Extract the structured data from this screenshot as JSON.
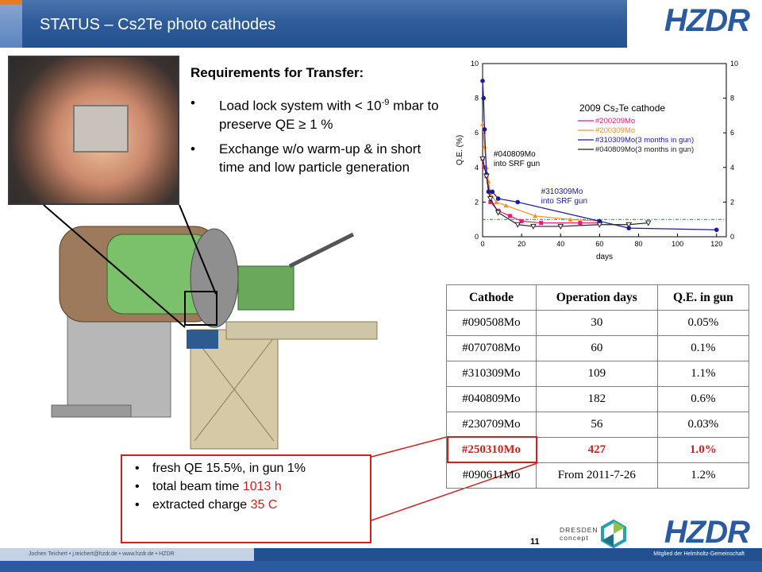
{
  "header": {
    "title": "STATUS – Cs2Te photo cathodes",
    "logo": "HZDR"
  },
  "requirements": {
    "title": "Requirements for Transfer:",
    "items": [
      {
        "text_before": "Load lock system with < 10",
        "sup": "-9",
        "text_after": " mbar to preserve QE  ≥ 1 %"
      },
      {
        "text_before": "Exchange w/o warm-up & in short time and low particle generation",
        "sup": "",
        "text_after": ""
      }
    ]
  },
  "chart_data": {
    "type": "line",
    "title": "2009 Cs₂Te cathode",
    "xlabel": "days",
    "ylabel": "Q.E. (%)",
    "xlim": [
      0,
      125
    ],
    "ylim": [
      0,
      10
    ],
    "y2lim": [
      0,
      10
    ],
    "xticks": [
      0,
      20,
      40,
      60,
      80,
      100,
      120
    ],
    "yticks": [
      0,
      2,
      4,
      6,
      8,
      10
    ],
    "y2ticks": [
      0,
      2,
      4,
      6,
      8,
      10
    ],
    "threshold": 1,
    "legend_position": "right",
    "annotations": [
      {
        "text": "#040809Mo",
        "text2": "into SRF gun",
        "x": 4,
        "y": 4.4
      },
      {
        "text": "#310309Mo",
        "text2": "into SRF gun",
        "x": 37,
        "y": 2.5
      }
    ],
    "series": [
      {
        "name": "#200209Mo",
        "color": "#e8197a",
        "marker": "square",
        "x": [
          0,
          1,
          2,
          4,
          8,
          14,
          20,
          30,
          50,
          60
        ],
        "y": [
          4.5,
          4.0,
          3.5,
          2.0,
          1.5,
          1.2,
          0.9,
          0.8,
          0.8,
          0.8
        ]
      },
      {
        "name": "#200309Mo",
        "color": "#f0902a",
        "marker": "triangle",
        "x": [
          0,
          1,
          2,
          3,
          4,
          7,
          12,
          27,
          45,
          60
        ],
        "y": [
          6.5,
          5.2,
          4.0,
          3.2,
          2.5,
          2.0,
          1.8,
          1.2,
          1.0,
          0.9
        ]
      },
      {
        "name": "#310309Mo(3 months in gun)",
        "color": "#1a1aa8",
        "marker": "circle",
        "x": [
          0,
          0.5,
          1,
          2,
          3,
          5,
          8,
          18,
          60,
          75,
          120
        ],
        "y": [
          9.0,
          8.0,
          6.2,
          3.6,
          2.6,
          2.6,
          2.2,
          2.0,
          0.9,
          0.5,
          0.4
        ]
      },
      {
        "name": "#040809Mo(3 months in gun)",
        "color": "#222222",
        "marker": "triangle-down",
        "x": [
          0,
          2,
          4,
          8,
          18,
          26,
          40,
          60,
          75,
          85
        ],
        "y": [
          4.5,
          3.5,
          2.2,
          1.4,
          0.7,
          0.6,
          0.6,
          0.7,
          0.7,
          0.8
        ]
      }
    ]
  },
  "table": {
    "headers": [
      "Cathode",
      "Operation days",
      "Q.E. in gun"
    ],
    "rows": [
      [
        "#090508Mo",
        "30",
        "0.05%"
      ],
      [
        "#070708Mo",
        "60",
        "0.1%"
      ],
      [
        "#310309Mo",
        "109",
        "1.1%"
      ],
      [
        "#040809Mo",
        "182",
        "0.6%"
      ],
      [
        "#230709Mo",
        "56",
        "0.03%"
      ],
      [
        "#250310Mo",
        "427",
        "1.0%"
      ],
      [
        "#090611Mo",
        "From 2011-7-26",
        "1.2%"
      ]
    ],
    "highlight_row": 5
  },
  "info": {
    "item1": "fresh QE 15.5%, in gun 1%",
    "item2_prefix": "total beam time ",
    "item2_value": "1013 h",
    "item3_prefix": "extracted charge ",
    "item3_value": "35 C"
  },
  "footer": {
    "author_line": "Jochen Teichert  •  j.teichert@hzdr.de  •  www.hzdr.de  •  HZDR",
    "page_number": "11",
    "member": "Mitglied der Helmholtz-Gemeinschaft",
    "partner_line1": "DRESDEN",
    "partner_line2": "concept"
  },
  "colors": {
    "brand_blue": "#2a5aa0",
    "accent_orange": "#e48a2b",
    "highlight_red": "#d01f1f"
  }
}
